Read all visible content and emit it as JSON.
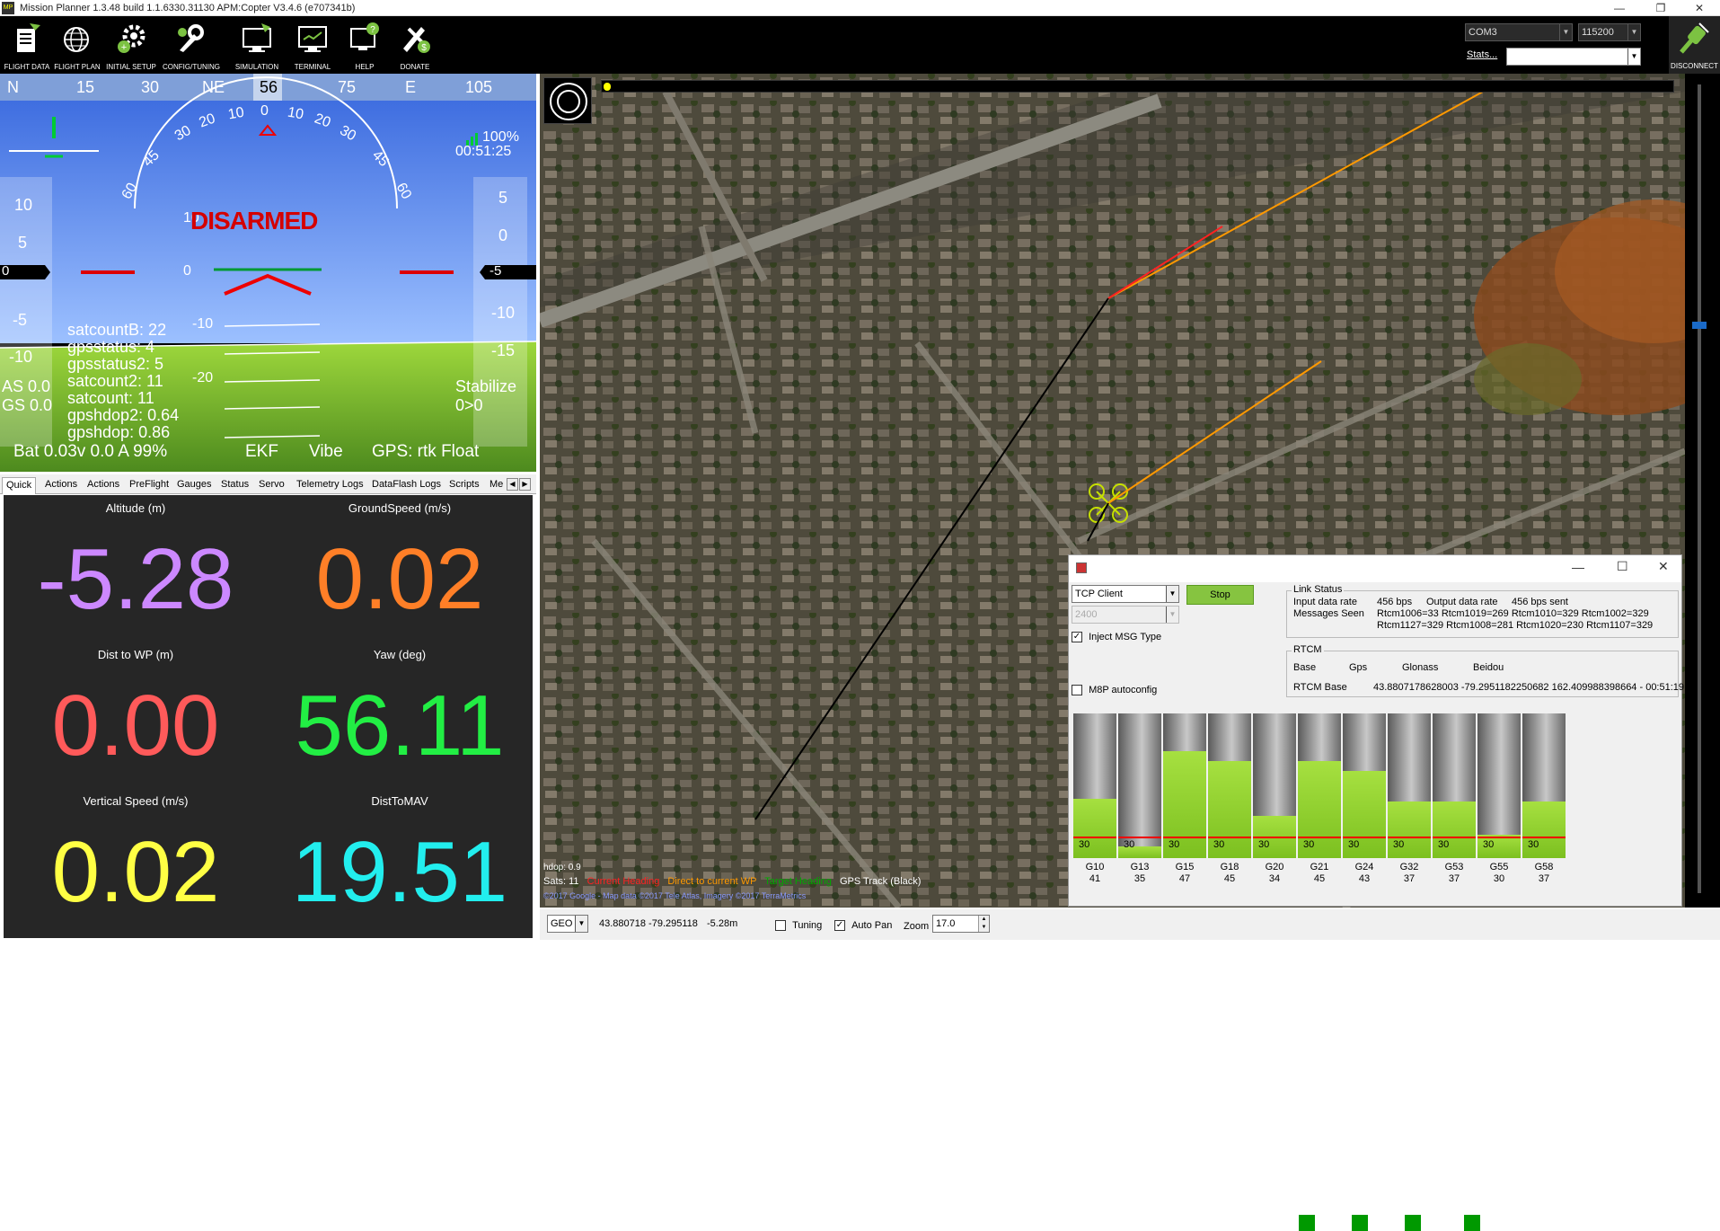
{
  "window": {
    "title": "Mission Planner 1.3.48 build 1.1.6330.31130 APM:Copter V3.4.6 (e707341b)",
    "controls": [
      "—",
      "❐",
      "✕"
    ]
  },
  "toolbar": {
    "buttons": [
      {
        "label": "FLIGHT DATA",
        "icon": "flight-data-icon"
      },
      {
        "label": "FLIGHT PLAN",
        "icon": "flight-plan-icon"
      },
      {
        "label": "INITIAL SETUP",
        "icon": "initial-setup-icon"
      },
      {
        "label": "CONFIG/TUNING",
        "icon": "config-tuning-icon"
      },
      {
        "label": "SIMULATION",
        "icon": "simulation-icon"
      },
      {
        "label": "TERMINAL",
        "icon": "terminal-icon"
      },
      {
        "label": "HELP",
        "icon": "help-icon"
      },
      {
        "label": "DONATE",
        "icon": "donate-icon"
      }
    ],
    "port": "COM3",
    "baud": "115200",
    "stats_label": "Stats...",
    "disconnect_label": "DISCONNECT"
  },
  "hud": {
    "heading_tape": [
      "N",
      "15",
      "30",
      "NE",
      "56",
      "75",
      "E",
      "105"
    ],
    "heading_current": "56",
    "roll_marks": [
      "60",
      "45",
      "30",
      "20",
      "10",
      "0",
      "10",
      "20",
      "30",
      "45",
      "60"
    ],
    "speed_tape": [
      "10",
      "5",
      "0",
      "-5",
      "-10"
    ],
    "speed_current": "0",
    "alt_tape": [
      "5",
      "0",
      "-10",
      "-15"
    ],
    "alt_current": "-5",
    "pitch_marks": [
      "10",
      "0",
      "-10",
      "-20"
    ],
    "battery_pct": "100%",
    "time": "00:51:25",
    "armed_status": "DISARMED",
    "messages": [
      "satcountB: 22",
      "gpsstatus: 4",
      "gpsstatus2: 5",
      "satcount2: 11",
      "satcount: 11",
      "gpshdop2: 0.64",
      "gpshdop: 0.86"
    ],
    "airspeed": "AS 0.0",
    "groundspeed": "GS 0.0",
    "mode": "Stabilize",
    "wp": "0>0",
    "battery": "Bat 0.03v 0.0 A 99%",
    "ekf": "EKF",
    "vibe": "Vibe",
    "gps": "GPS: rtk Float"
  },
  "tabs": [
    "Quick",
    "Actions",
    "Actions",
    "PreFlight",
    "Gauges",
    "Status",
    "Servo",
    "Telemetry Logs",
    "DataFlash Logs",
    "Scripts",
    "Me"
  ],
  "quick": [
    {
      "label": "Altitude (m)",
      "value": "-5.28",
      "color": "#cc88ff"
    },
    {
      "label": "GroundSpeed (m/s)",
      "value": "0.02",
      "color": "#ff7f27"
    },
    {
      "label": "Dist to WP (m)",
      "value": "0.00",
      "color": "#ff5a5a"
    },
    {
      "label": "Yaw (deg)",
      "value": "56.11",
      "color": "#22ee44"
    },
    {
      "label": "Vertical Speed (m/s)",
      "value": "0.02",
      "color": "#ffff44"
    },
    {
      "label": "DistToMAV",
      "value": "19.51",
      "color": "#22eeee"
    }
  ],
  "map": {
    "hdop": "hdop: 0.9",
    "sats": "Sats: 11",
    "legend": [
      {
        "text": "Current Heading",
        "color": "#ff2222"
      },
      {
        "text": "Direct to current WP",
        "color": "#ff9900"
      },
      {
        "text": "Target Heading",
        "color": "#00aa00"
      },
      {
        "text": "GPS Track (Black)",
        "color": "#ffffff"
      }
    ],
    "copyright": "©2017 Google - Map data ©2017 Tele Atlas, Imagery ©2017 TerraMetrics"
  },
  "rtk": {
    "connection": "TCP Client",
    "baud_disabled": "2400",
    "stop_button": "Stop",
    "inject_label": "Inject MSG Type",
    "m8p_label": "M8P autoconfig",
    "link_status_title": "Link Status",
    "input_rate_label": "Input data rate",
    "input_rate": "456 bps",
    "output_rate_label": "Output data rate",
    "output_rate": "456 bps sent",
    "messages_seen_label": "Messages Seen",
    "messages_line1": "Rtcm1006=33 Rtcm1019=269 Rtcm1010=329 Rtcm1002=329",
    "messages_line2": "Rtcm1127=329 Rtcm1008=281 Rtcm1020=230 Rtcm1107=329",
    "rtcm_title": "RTCM",
    "indicators": [
      "Base",
      "Gps",
      "Glonass",
      "Beidou"
    ],
    "rtcm_base_label": "RTCM Base",
    "rtcm_base_value": "43.8807178628003 -79.2951182250682 162.409988398664 - 00:51:19",
    "threshold": "30",
    "sats": [
      {
        "id": "G10",
        "snr": "41",
        "level": 0.41
      },
      {
        "id": "G13",
        "snr": "35",
        "level": 0.08
      },
      {
        "id": "G15",
        "snr": "47",
        "level": 0.74
      },
      {
        "id": "G18",
        "snr": "45",
        "level": 0.67
      },
      {
        "id": "G20",
        "snr": "34",
        "level": 0.29
      },
      {
        "id": "G21",
        "snr": "45",
        "level": 0.67
      },
      {
        "id": "G24",
        "snr": "43",
        "level": 0.6
      },
      {
        "id": "G32",
        "snr": "37",
        "level": 0.39
      },
      {
        "id": "G53",
        "snr": "37",
        "level": 0.39
      },
      {
        "id": "G55",
        "snr": "30",
        "level": 0.16
      },
      {
        "id": "G58",
        "snr": "37",
        "level": 0.39
      }
    ]
  },
  "bottombar": {
    "coord_type": "GEO",
    "coords": "43.880718 -79.295118",
    "alt": "-5.28m",
    "tuning": "Tuning",
    "autopan": "Auto Pan",
    "zoom_label": "Zoom",
    "zoom": "17.0"
  }
}
